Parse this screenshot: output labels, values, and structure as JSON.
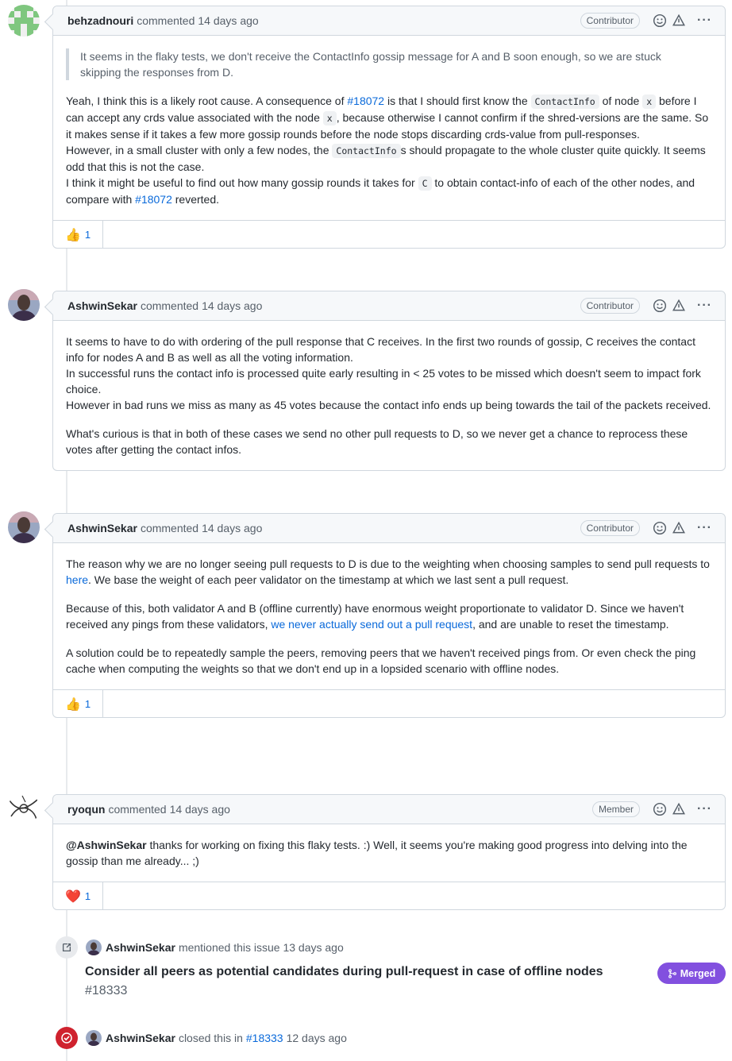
{
  "colors": {
    "link": "#0969da",
    "merged": "#8250df",
    "closed": "#cf222e",
    "border": "#d0d7de"
  },
  "comments": [
    {
      "author": "behzadnouri",
      "action": "commented",
      "time": "14 days ago",
      "role": "Contributor",
      "avatar_icon": "identicon-avatar",
      "quote": "It seems in the flaky tests, we don't receive the ContactInfo gossip message for A and B soon enough, so we are stuck skipping the responses from D.",
      "p1a": "Yeah, I think this is a likely root cause. A consequence of ",
      "p1link": "#18072",
      "p1b": " is that I should first know the ",
      "p1code": "ContactInfo",
      "p1c": " of node ",
      "p1code2": "x",
      "p1d": " before I can accept any crds value associated with the node ",
      "p1code3": "x",
      "p1e": ", because otherwise I cannot confirm if the shred-versions are the same. So it makes sense if it takes a few more gossip rounds before the node stops discarding crds-value from pull-responses.",
      "p2a": "However, in a small cluster with only a few nodes, the ",
      "p2code": "ContactInfo",
      "p2b": "s should propagate to the whole cluster quite quickly. It seems odd that this is not the case.",
      "p3a": "I think it might be useful to find out how many gossip rounds it takes for ",
      "p3code": "C",
      "p3b": " to obtain contact-info of each of the other nodes, and compare with ",
      "p3link": "#18072",
      "p3c": " reverted.",
      "reaction_emoji": "👍",
      "reaction_count": "1"
    },
    {
      "author": "AshwinSekar",
      "action": "commented",
      "time": "14 days ago",
      "role": "Contributor",
      "avatar_icon": "user-photo-avatar",
      "l1": "It seems to have to do with ordering of the pull response that C receives. In the first two rounds of gossip, C receives the contact info for nodes A and B as well as all the voting information.",
      "l2": "In successful runs the contact info is processed quite early resulting in < 25 votes to be missed which doesn't seem to impact fork choice.",
      "l3": "However in bad runs we miss as many as 45 votes because the contact info ends up being towards the tail of the packets received.",
      "l4": "What's curious is that in both of these cases we send no other pull requests to D, so we never get a chance to reprocess these votes after getting the contact infos."
    },
    {
      "author": "AshwinSekar",
      "action": "commented",
      "time": "14 days ago",
      "role": "Contributor",
      "avatar_icon": "user-photo-avatar",
      "p1a": "The reason why we are no longer seeing pull requests to D is due to the weighting when choosing samples to send pull requests to ",
      "p1link": "here",
      "p1b": ". We base the weight of each peer validator on the timestamp at which we last sent a pull request.",
      "p2a": "Because of this, both validator A and B (offline currently) have enormous weight proportionate to validator D. Since we haven't received any pings from these validators, ",
      "p2link": "we never actually send out a pull request",
      "p2b": ", and are unable to reset the timestamp.",
      "p3": "A solution could be to repeatedly sample the peers, removing peers that we haven't received pings from. Or even check the ping cache when computing the weights so that we don't end up in a lopsided scenario with offline nodes.",
      "reaction_emoji": "👍",
      "reaction_count": "1"
    },
    {
      "author": "ryoqun",
      "action": "commented",
      "time": "14 days ago",
      "role": "Member",
      "avatar_icon": "line-art-avatar",
      "mention": "@AshwinSekar",
      "text": " thanks for working on fixing this flaky tests. :) Well, it seems you're making good progress into delving into the gossip than me already... ;)",
      "reaction_emoji": "❤️",
      "reaction_count": "1"
    }
  ],
  "events": {
    "mention": {
      "author": "AshwinSekar",
      "text": "mentioned this issue 13 days ago",
      "ref_title": "Consider all peers as potential candidates during pull-request in case of offline nodes",
      "ref_number": "#18333",
      "state": "Merged"
    },
    "closed": {
      "author": "AshwinSekar",
      "text_a": "closed this in",
      "ref": "#18333",
      "text_b": "12 days ago"
    }
  }
}
